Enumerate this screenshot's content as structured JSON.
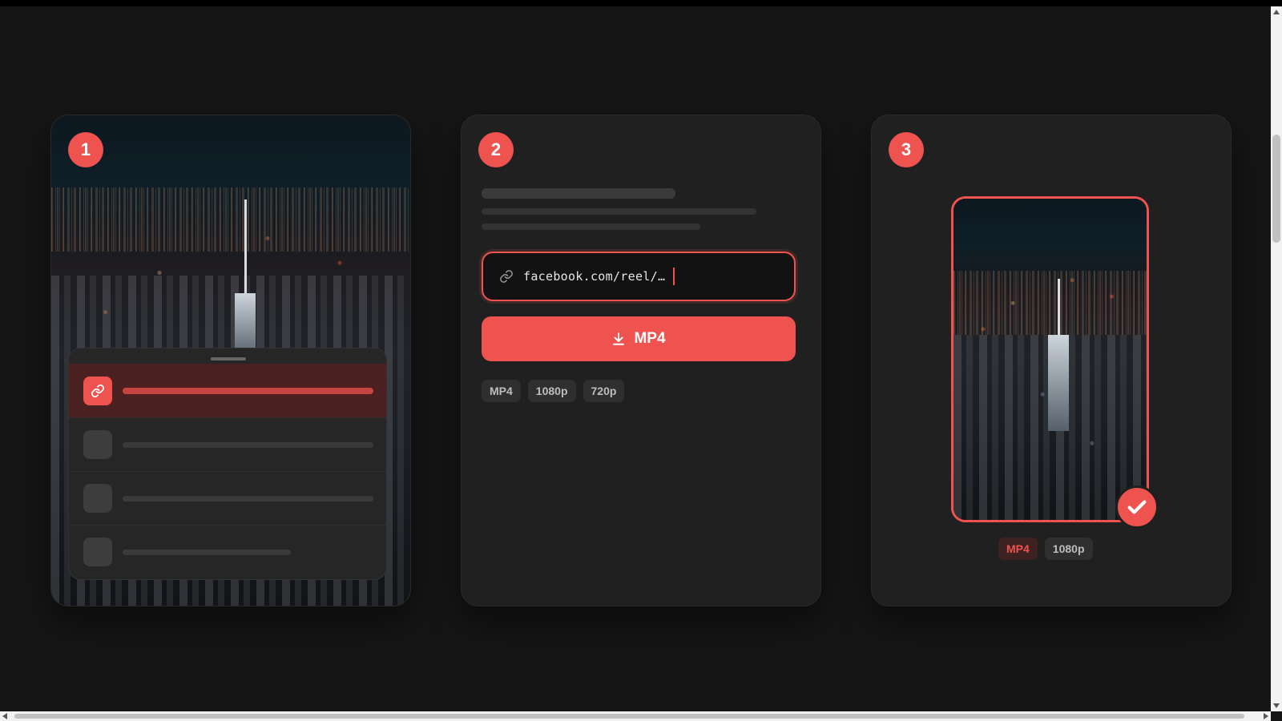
{
  "theme": {
    "accent": "#ef5350",
    "background": "#151515",
    "card": "#202020"
  },
  "steps": [
    {
      "number": "1"
    },
    {
      "number": "2"
    },
    {
      "number": "3"
    }
  ],
  "card1": {
    "sheet_rows": [
      {
        "icon": "link-icon",
        "state": "active"
      },
      {
        "icon": "placeholder-icon",
        "state": "idle"
      },
      {
        "icon": "placeholder-icon",
        "state": "idle"
      },
      {
        "icon": "placeholder-icon",
        "state": "idle"
      }
    ]
  },
  "card2": {
    "url_input": {
      "icon": "link-icon",
      "value": "facebook.com/reel/…"
    },
    "download_button": {
      "icon": "download-icon",
      "label": "MP4"
    },
    "format_chips": [
      "MP4",
      "1080p",
      "720p"
    ]
  },
  "card3": {
    "status_icon": "checkmark-icon",
    "result_chips": [
      {
        "label": "MP4",
        "highlight": true
      },
      {
        "label": "1080p",
        "highlight": false
      }
    ]
  }
}
